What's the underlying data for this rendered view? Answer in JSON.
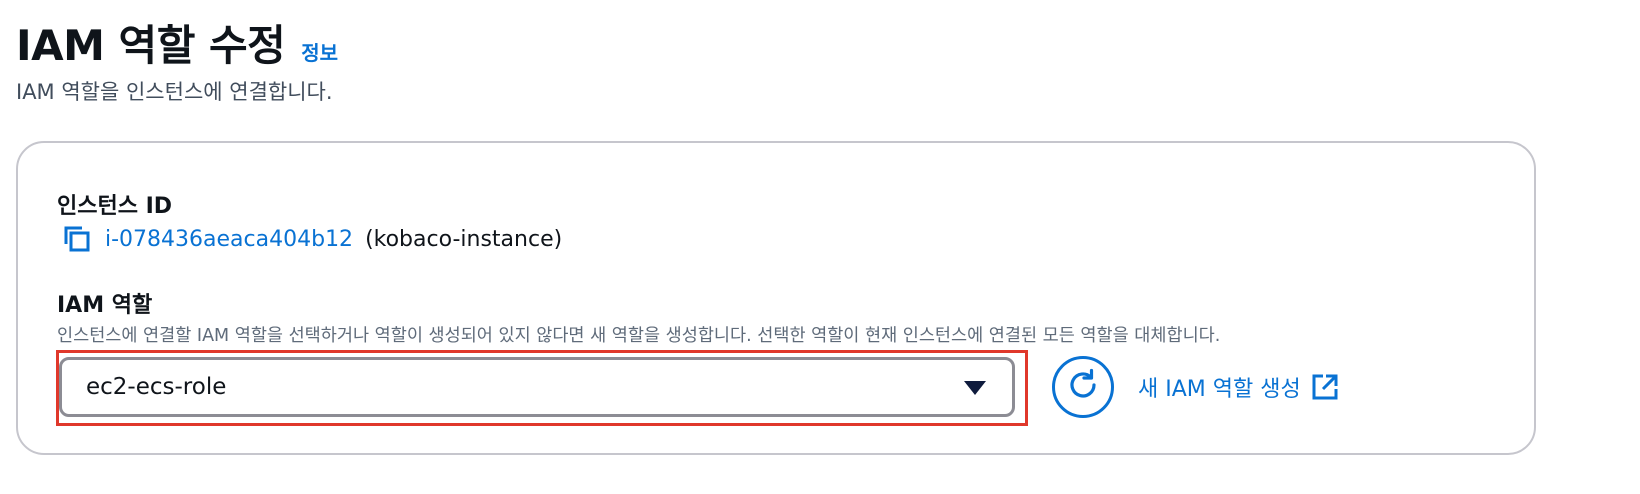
{
  "header": {
    "title": "IAM 역할 수정",
    "info_link": "정보",
    "description": "IAM 역할을 인스턴스에 연결합니다."
  },
  "instance": {
    "label": "인스턴스 ID",
    "id": "i-078436aeaca404b12",
    "name": "(kobaco-instance)",
    "copy_icon": "copy-icon"
  },
  "iam_role": {
    "label": "IAM 역할",
    "hint": "인스턴스에 연결할 IAM 역할을 선택하거나 역할이 생성되어 있지 않다면 새 역할을 생성합니다. 선택한 역할이 현재 인스턴스에 연결된 모든 역할을 대체합니다.",
    "selected": "ec2-ecs-role",
    "caret_icon": "caret-down-icon",
    "refresh_icon": "refresh-icon",
    "create_link": "새 IAM 역할 생성",
    "external_icon": "external-link-icon"
  },
  "colors": {
    "link": "#0972d3",
    "highlight": "#e0382b",
    "text": "#0f141a",
    "muted": "#5f6b7a",
    "border": "#c6c6cd"
  }
}
